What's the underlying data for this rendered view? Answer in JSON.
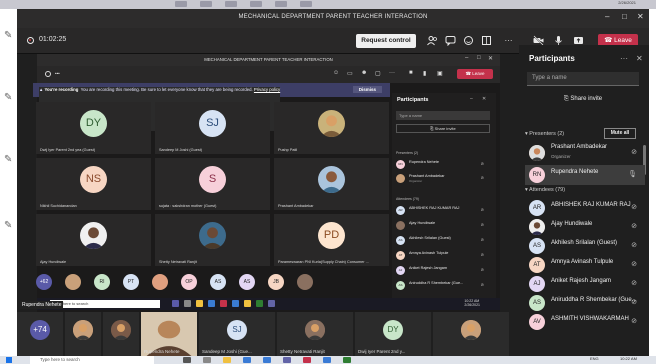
{
  "meeting": {
    "title": "MECHANICAL DEPARTMENT PARENT TEACHER INTERACTION",
    "elapsed": "01:02:25",
    "request_control_label": "Request control",
    "leave_label": "Leave"
  },
  "inner": {
    "title": "MECHANICAL DEPARTMENT PARENT TEACHER INTERACTION",
    "leave_label": "Leave",
    "banner_bold": "You're recording",
    "banner_text": "You are recording this meeting. Be sure to let everyone know that they are being recorded.",
    "banner_link": "Privacy policy",
    "banner_dismiss": "Dismiss",
    "tiles": [
      {
        "initials": "DY",
        "name": "Dwij Iyer Parent 2nd yea (Guest)",
        "bg": "#c8e6c9",
        "fg": "#2e5d31"
      },
      {
        "initials": "SJ",
        "name": "Sandeep M Joshi (Guest)",
        "bg": "#d7e3f4",
        "fg": "#2d4e7a"
      },
      {
        "initials": "",
        "name": "Pushp Patil",
        "bg": "photo",
        "fg": ""
      },
      {
        "initials": "NS",
        "name": "Nikhil Suchidanandan",
        "bg": "#f7d6c3",
        "fg": "#8a4a2c"
      },
      {
        "initials": "S",
        "name": "sujata : sakshdran mother (Guest)",
        "bg": "#f7d0da",
        "fg": "#8a2e48"
      },
      {
        "initials": "",
        "name": "Prashant Ambadekar",
        "bg": "photo",
        "fg": ""
      },
      {
        "initials": "",
        "name": "Ajay Hundiwale",
        "bg": "photo",
        "fg": ""
      },
      {
        "initials": "",
        "name": "Shetty Netravati Ranjit",
        "bg": "photo",
        "fg": ""
      },
      {
        "initials": "PD",
        "name": "Parameswaran PNI Kurla(Supply Chain) Consumer ...",
        "bg": "#fde5cf",
        "fg": "#8a4a20"
      }
    ],
    "strip": [
      {
        "label": "+62",
        "bg": "#5a5aa8"
      },
      {
        "label": "",
        "bg": "#c9a07a"
      },
      {
        "label": "RI",
        "bg": "#c8e6c9"
      },
      {
        "label": "PT",
        "bg": "#d7e3f4"
      },
      {
        "label": "",
        "bg": "#e0a080"
      },
      {
        "label": "OP",
        "bg": "#f7d0da"
      },
      {
        "label": "AS",
        "bg": "#d7e3f4"
      },
      {
        "label": "AS",
        "bg": "#e3d7f4"
      },
      {
        "label": "JB",
        "bg": "#f7d6c3"
      },
      {
        "label": "",
        "bg": "#8a7060"
      }
    ],
    "participants_title": "Participants",
    "search_placeholder": "Type a name",
    "share_invite": "Share invite",
    "presenters": "Presenters (2)",
    "attendees": "Attendees (79)",
    "list": [
      {
        "initials": "RN",
        "name": "Rupendra Nehete",
        "sub": "",
        "bg": "#f7d0da"
      },
      {
        "initials": "",
        "name": "Prashant Ambadekar",
        "sub": "Organizer",
        "bg": "#c9a07a"
      },
      {
        "initials": "AR",
        "name": "ABHISHEK RAJ KUMAR RAJ",
        "sub": "",
        "bg": "#d7e3f4"
      },
      {
        "initials": "",
        "name": "Ajay Hundiwale",
        "sub": "",
        "bg": "#8a7060"
      },
      {
        "initials": "AS",
        "name": "Akhilesh Srilalan (Guest)",
        "sub": "",
        "bg": "#d7e3f4"
      },
      {
        "initials": "AT",
        "name": "Amnya Avinash Tulpule",
        "sub": "",
        "bg": "#f7d6c3"
      },
      {
        "initials": "AJ",
        "name": "Aniket Rajesh Jangam",
        "sub": "",
        "bg": "#e3d7f4"
      },
      {
        "initials": "AS",
        "name": "Aniruddha R Shembekar (Gue...",
        "sub": "",
        "bg": "#c8e6c9"
      }
    ],
    "taskbar_search": "Type here to search",
    "taskbar_time": "10:22 AM",
    "taskbar_date": "2/26/2021",
    "presenter_label": "Rupendra Nehete"
  },
  "panel": {
    "title": "Participants",
    "search_placeholder": "Type a name",
    "share_invite": "Share invite",
    "presenters_label": "Presenters (2)",
    "mute_all": "Mute all",
    "attendees_label": "Attendees (79)",
    "presenters": [
      {
        "initials": "",
        "name": "Prashant Ambadekar",
        "sub": "Organizer",
        "bg": "#c9a07a"
      },
      {
        "initials": "RN",
        "name": "Rupendra Nehete",
        "sub": "",
        "bg": "#f7d0da"
      }
    ],
    "attendees": [
      {
        "initials": "AR",
        "name": "ABHISHEK RAJ KUMAR RAJ",
        "bg": "#d7e3f4"
      },
      {
        "initials": "",
        "name": "Ajay Hundiwale",
        "bg": "#8a7060"
      },
      {
        "initials": "AS",
        "name": "Akhilesh Srilalan (Guest)",
        "bg": "#d7e3f4"
      },
      {
        "initials": "AT",
        "name": "Amnya Avinash Tulpule",
        "bg": "#f7d6c3"
      },
      {
        "initials": "AJ",
        "name": "Aniket Rajesh Jangam",
        "bg": "#e3d7f4"
      },
      {
        "initials": "AS",
        "name": "Aniruddha R Shembekar (Gue...",
        "bg": "#c8e6c9"
      },
      {
        "initials": "AV",
        "name": "ASHMITH VISHWAKARMAH",
        "bg": "#f7d0da"
      }
    ]
  },
  "bottom": {
    "tiles": [
      {
        "label": "+74",
        "name": "",
        "bg": "#5a5aa8",
        "fg": "#fff"
      },
      {
        "label": "",
        "name": "",
        "bg": "#c9a07a",
        "fg": ""
      },
      {
        "label": "",
        "name": "",
        "bg": "#7a5a48",
        "fg": ""
      },
      {
        "label": "",
        "name": "Rupendra Nehete",
        "bg": "photo",
        "fg": ""
      },
      {
        "label": "SJ",
        "name": "Sandeep M Joshi (Gue...",
        "bg": "#d7e3f4",
        "fg": "#2d4e7a"
      },
      {
        "label": "",
        "name": "Shetty Netravati Ranjit",
        "bg": "#8a7060",
        "fg": ""
      },
      {
        "label": "DY",
        "name": "Dwij Iyer Parent 2nd y...",
        "bg": "#c8e6c9",
        "fg": "#2e5d31"
      },
      {
        "label": "",
        "name": "",
        "bg": "#c9a07a",
        "fg": ""
      }
    ]
  },
  "taskbar": {
    "search_placeholder": "Type here to search",
    "time": "10:22 AM",
    "lang": "ENG"
  },
  "top": {
    "clock": "2/26/2021"
  }
}
